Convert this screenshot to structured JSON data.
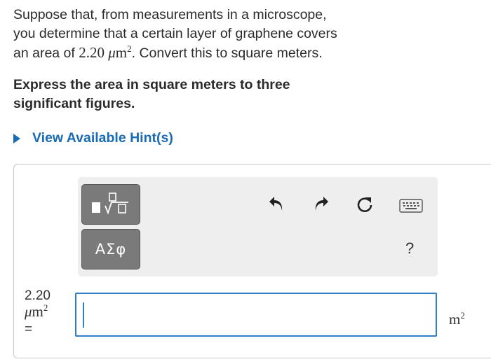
{
  "question": {
    "line1": "Suppose that, from measurements in a microscope,",
    "line2": "you determine that a certain layer of graphene covers",
    "line3_prefix": "an area of ",
    "value": "2.20",
    "unit_mu": "μ",
    "unit_m": "m",
    "unit_exp": "2",
    "line3_suffix": ". Convert this to square meters."
  },
  "instruction": {
    "line1": "Express the area in square meters to three",
    "line2": "significant figures."
  },
  "hint": {
    "label": "View Available Hint(s)"
  },
  "toolbar": {
    "greek_label": "ΑΣφ",
    "help_label": "?",
    "icons": [
      "templates-icon",
      "greek-symbols-icon",
      "undo-icon",
      "redo-icon",
      "reset-icon",
      "keyboard-icon",
      "help-icon"
    ]
  },
  "answer": {
    "lhs_value": "2.20",
    "lhs_unit_mu": "μ",
    "lhs_unit_m": "m",
    "lhs_unit_exp": "2",
    "lhs_eq": "=",
    "input_value": "",
    "rhs_unit": "m",
    "rhs_exp": "2"
  },
  "colors": {
    "accent": "#1a6bb5",
    "input_border": "#2e7ec7",
    "button_gray": "#7a7a7a",
    "toolbar_bg": "#eeeeee"
  }
}
